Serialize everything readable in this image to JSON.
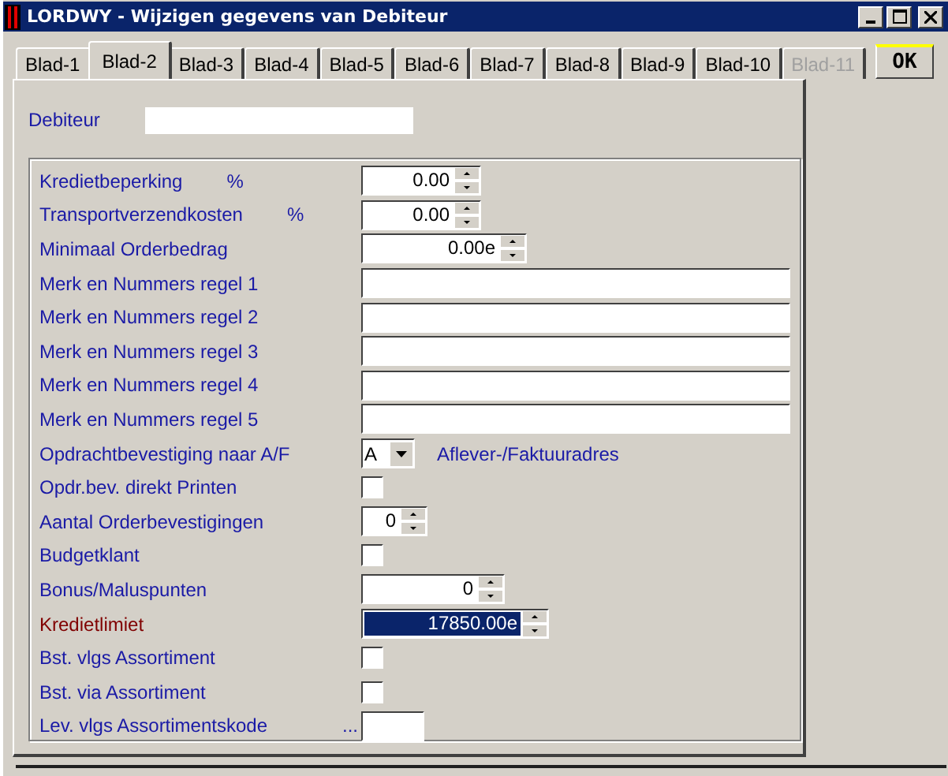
{
  "window": {
    "title": "LORDWY - Wijzigen gegevens van Debiteur"
  },
  "tabs": [
    {
      "label": "Blad-1",
      "selected": false,
      "disabled": false
    },
    {
      "label": "Blad-2",
      "selected": true,
      "disabled": false
    },
    {
      "label": "Blad-3",
      "selected": false,
      "disabled": false
    },
    {
      "label": "Blad-4",
      "selected": false,
      "disabled": false
    },
    {
      "label": "Blad-5",
      "selected": false,
      "disabled": false
    },
    {
      "label": "Blad-6",
      "selected": false,
      "disabled": false
    },
    {
      "label": "Blad-7",
      "selected": false,
      "disabled": false
    },
    {
      "label": "Blad-8",
      "selected": false,
      "disabled": false
    },
    {
      "label": "Blad-9",
      "selected": false,
      "disabled": false
    },
    {
      "label": "Blad-10",
      "selected": false,
      "disabled": false
    },
    {
      "label": "Blad-11",
      "selected": false,
      "disabled": true
    }
  ],
  "ok_button": "OK",
  "debiteur": {
    "label": "Debiteur"
  },
  "rows": [
    {
      "kind": "spin",
      "label": "Kredietbeperking",
      "unit": "%",
      "value": "0.00",
      "focused": false
    },
    {
      "kind": "spin",
      "label": "Transportverzendkosten",
      "unit": "%",
      "value": "0.00",
      "focused": false
    },
    {
      "kind": "spin",
      "label": "Minimaal Orderbedrag",
      "value": "0.00e",
      "focused": false
    },
    {
      "kind": "text",
      "label": "Merk en Nummers regel 1",
      "focused": false
    },
    {
      "kind": "text",
      "label": "Merk en Nummers regel 2",
      "focused": false
    },
    {
      "kind": "text",
      "label": "Merk en Nummers regel 3",
      "focused": false
    },
    {
      "kind": "text",
      "label": "Merk en Nummers regel 4",
      "focused": false
    },
    {
      "kind": "text",
      "label": "Merk en Nummers regel 5",
      "focused": false
    },
    {
      "kind": "combo",
      "label": "Opdrachtbevestiging naar A/F",
      "value": "A",
      "note": "Aflever-/Faktuuradres",
      "focused": false
    },
    {
      "kind": "check",
      "label": "Opdr.bev. direkt Printen",
      "checked": false,
      "focused": false
    },
    {
      "kind": "spin",
      "label": "Aantal Orderbevestigingen",
      "value": "0",
      "focused": false
    },
    {
      "kind": "check",
      "label": "Budgetklant",
      "checked": false,
      "focused": false
    },
    {
      "kind": "spin",
      "label": "Bonus/Maluspunten",
      "value": "0",
      "focused": false
    },
    {
      "kind": "spin",
      "label": "Kredietlimiet",
      "value": "17850.00e",
      "focused": true
    },
    {
      "kind": "check",
      "label": "Bst. vlgs Assortiment",
      "checked": false,
      "focused": false
    },
    {
      "kind": "check",
      "label": "Bst. via  Assortiment",
      "checked": false,
      "focused": false
    },
    {
      "kind": "text",
      "label": "Lev. vlgs Assortimentskode",
      "prefix": "...",
      "focused": false
    }
  ]
}
